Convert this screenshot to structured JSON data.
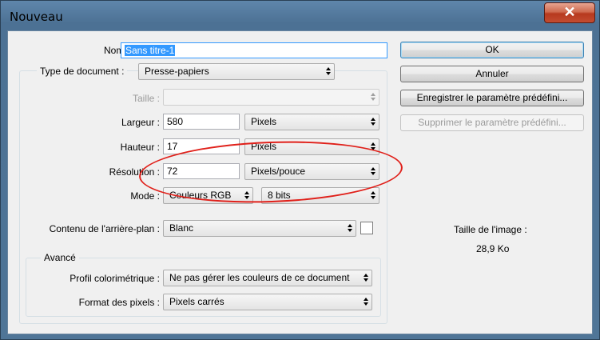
{
  "window": {
    "title": "Nouveau",
    "close_glyph": "✕"
  },
  "form": {
    "nom_label": "Nom :",
    "nom_value": "Sans titre-1",
    "type_label": "Type de document :",
    "type_value": "Presse-papiers",
    "taille_label": "Taille :",
    "taille_value": "",
    "largeur_label": "Largeur :",
    "largeur_value": "580",
    "largeur_unit": "Pixels",
    "hauteur_label": "Hauteur :",
    "hauteur_value": "17",
    "hauteur_unit": "Pixels",
    "resolution_label": "Résolution :",
    "resolution_value": "72",
    "resolution_unit": "Pixels/pouce",
    "mode_label": "Mode :",
    "mode_value": "Couleurs RGB",
    "bits_value": "8 bits",
    "contenu_label": "Contenu de l'arrière-plan :",
    "contenu_value": "Blanc",
    "background_swatch_color": "#ffffff"
  },
  "advanced": {
    "title": "Avancé",
    "profil_label": "Profil colorimétrique :",
    "profil_value": "Ne pas gérer les couleurs de ce document",
    "format_label": "Format des pixels :",
    "format_value": "Pixels carrés"
  },
  "buttons": {
    "ok": "OK",
    "annuler": "Annuler",
    "enregistrer": "Enregistrer le paramètre prédéfini...",
    "supprimer": "Supprimer le paramètre prédéfini..."
  },
  "info": {
    "size_label": "Taille de l'image :",
    "size_value": "28,9 Ko"
  },
  "annotation": {
    "ellipse_color": "#e0201a"
  }
}
